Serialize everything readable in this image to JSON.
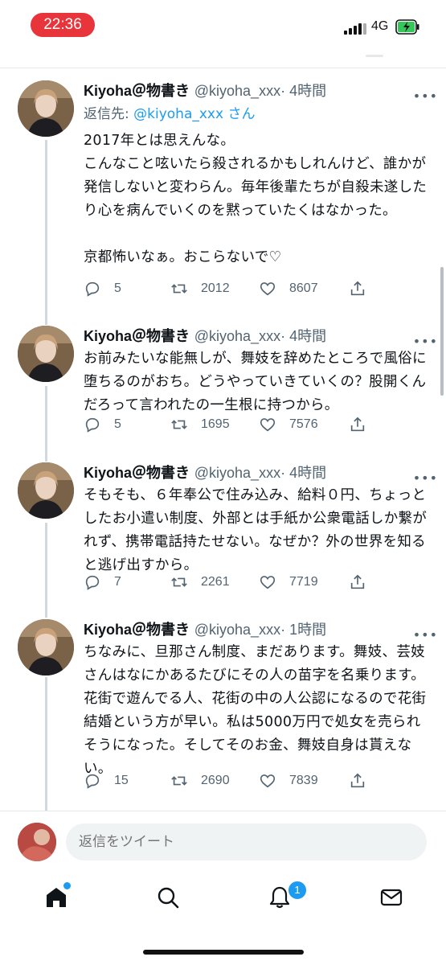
{
  "status": {
    "time": "22:36",
    "network": "4G"
  },
  "tweets": [
    {
      "name": "Kiyoha＠物書き",
      "handle": "@kiyoha_xxx",
      "time": "· 4時間",
      "reply_prefix": "返信先:",
      "reply_to": "@kiyoha_xxx さん",
      "text": "2017年とは思えんな。\nこんなこと呟いたら殺されるかもしれんけど、誰かが発信しないと変わらん。毎年後輩たちが自殺未遂したり心を病んでいくのを黙っていたくはなかった。\n\n京都怖いなぁ。おこらないで♡",
      "replies": "5",
      "retweets": "2012",
      "likes": "8607"
    },
    {
      "name": "Kiyoha＠物書き",
      "handle": "@kiyoha_xxx",
      "time": "· 4時間",
      "text": "お前みたいな能無しが、舞妓を辞めたところで風俗に堕ちるのがおち。どうやっていきていくの？股開くんだろって言われたの一生根に持つから。",
      "replies": "5",
      "retweets": "1695",
      "likes": "7576"
    },
    {
      "name": "Kiyoha＠物書き",
      "handle": "@kiyoha_xxx",
      "time": "· 4時間",
      "text": "そもそも、６年奉公で住み込み、給料０円、ちょっとしたお小遣い制度、外部とは手紙か公衆電話しか繋がれず、携帯電話持たせない。なぜか？外の世界を知ると逃げ出すから。",
      "replies": "7",
      "retweets": "2261",
      "likes": "7719"
    },
    {
      "name": "Kiyoha＠物書き",
      "handle": "@kiyoha_xxx",
      "time": "· 1時間",
      "text": "ちなみに、旦那さん制度、まだあります。舞妓、芸妓さんはなにかあるたびにその人の苗字を名乗ります。花街で遊んでる人、花街の中の人公認になるので花街結婚という方が早い。私は5000万円で処女を売られそうになった。そしてそのお金、舞妓自身は貰えない。",
      "replies": "15",
      "retweets": "2690",
      "likes": "7839"
    }
  ],
  "reply_box": {
    "placeholder": "返信をツイート"
  },
  "tabs": {
    "notifications_badge": "1"
  },
  "colors": {
    "accent": "#1d9bf0",
    "time_pill": "#e8343b"
  }
}
